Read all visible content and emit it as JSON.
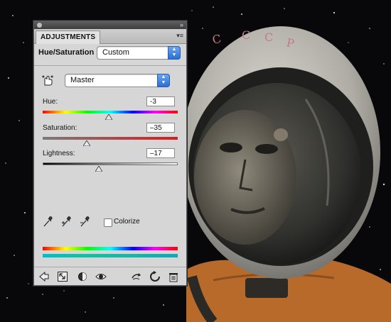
{
  "panel": {
    "tab_label": "ADJUSTMENTS",
    "adjustment_title": "Hue/Saturation",
    "preset_value": "Custom",
    "channel_value": "Master",
    "hue": {
      "label": "Hue:",
      "value": "-3",
      "level": -3
    },
    "saturation": {
      "label": "Saturation:",
      "value": "–35",
      "level": -35
    },
    "lightness": {
      "label": "Lightness:",
      "value": "–17",
      "level": -17
    },
    "colorize_label": "Colorize",
    "colorize_checked": false
  },
  "icons": {
    "targeted_adjust": "hand-adjust-icon",
    "eyedroppers": [
      "eyedropper-icon",
      "eyedropper-plus-icon",
      "eyedropper-minus-icon"
    ],
    "bottom": [
      "back-arrow-icon",
      "expand-view-icon",
      "clip-layer-icon",
      "visibility-eye-icon",
      "view-previous-icon",
      "reset-icon",
      "delete-icon"
    ]
  },
  "colors": {
    "panel_bg": "#d6d6d6",
    "select_arrow": "#2a6fd6"
  }
}
